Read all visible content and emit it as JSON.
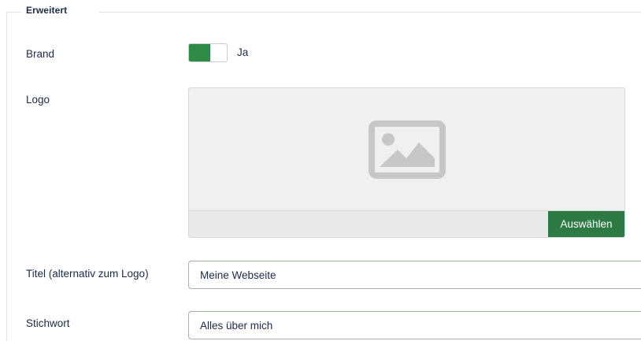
{
  "fieldset": {
    "legend": "Erweitert"
  },
  "fields": {
    "brand": {
      "label": "Brand",
      "toggle_state": "Ja",
      "on": true,
      "on_color": "#2f8a46"
    },
    "logo": {
      "label": "Logo",
      "preview_icon": "image-placeholder-icon",
      "path_value": "",
      "select_label": "Auswählen",
      "button_color": "#2e7a44"
    },
    "title": {
      "label": "Titel (alternativ zum Logo)",
      "value": "Meine Webseite"
    },
    "keyword": {
      "label": "Stichwort",
      "value": "Alles über mich"
    }
  }
}
